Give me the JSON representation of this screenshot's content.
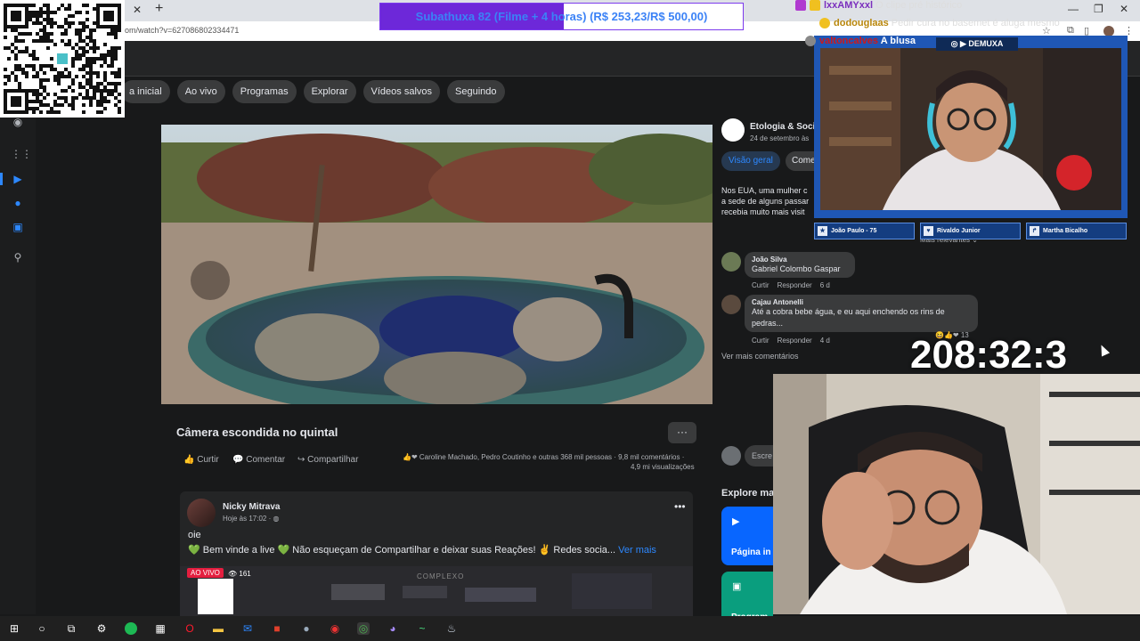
{
  "browser": {
    "url": "om/watch?v=627086802334471",
    "tab_close": "✕",
    "new_tab": "+",
    "window_controls": [
      "—",
      "❐",
      "✕"
    ]
  },
  "facebook": {
    "nav_pills": [
      "a inicial",
      "Ao vivo",
      "Programas",
      "Explorar",
      "Vídeos salvos",
      "Seguindo"
    ],
    "video": {
      "title": "Câmera escondida no quintal",
      "more": "···",
      "actions": {
        "like": "Curtir",
        "comment": "Comentar",
        "share": "Compartilhar"
      },
      "reactions": "Caroline Machado, Pedro Coutinho e outras 368 mil pessoas",
      "comments_count": "9,8 mil comentários ·",
      "views": "4,9 mi visualizações"
    },
    "side": {
      "page_name": "Etologia & Socio",
      "page_date": "24 de setembro às",
      "tab_overview": "Visão geral",
      "tab_comments": "Come",
      "description": [
        "Nos EUA, uma mulher c",
        "a sede de alguns passar",
        "recebia muito mais visit"
      ],
      "relevant": "Mais relevantes ⌄",
      "comments": [
        {
          "author": "João Silva",
          "text": "Gabriel Colombo Gaspar",
          "like": "Curtir",
          "reply": "Responder",
          "age": "6 d"
        },
        {
          "author": "Cajau Antonelli",
          "text1": "Até a cobra bebe água, e eu aqui enchendo os rins de",
          "text2": "pedras...",
          "like": "Curtir",
          "reply": "Responder",
          "age": "4 d",
          "reactions": "13"
        }
      ],
      "see_more_comments": "Ver mais comentários",
      "write_placeholder": "Escre",
      "explore_title": "Explore ma",
      "explore_cards": [
        {
          "label": "Página in",
          "icon": "▶"
        },
        {
          "label": "Program",
          "icon": "▣"
        }
      ]
    },
    "post": {
      "author": "Nicky Mitrava",
      "time": "Hoje às 17:02 · ",
      "line1": "oie",
      "line2": "💚 Bem vinde a live 💚 Não esqueçam de Compartilhar e deixar suas Reações! ✌ Redes socia... ",
      "see_more": "Ver mais",
      "live_badge": "AO VIVO",
      "viewers": "👁 161",
      "media_logo": "COMPLEXO"
    }
  },
  "overlay": {
    "subathon": "Subathuxa 82 (Filme + 4 horas) (R$ 253,23/R$ 500,00)",
    "subathon_progress": 0.5065,
    "chat": [
      {
        "user": "lxxAMYxxl",
        "message": "O clipe pré histórico",
        "color": "#7b2fbe"
      },
      {
        "user": "dodouglaas",
        "message": "Pedir cura no basemet é aluga mesmo",
        "color": "#b8860b"
      },
      {
        "user": "valtoncalves",
        "message": "A blusa",
        "color": "#d01818"
      }
    ],
    "cam_tag": "◎ ▶ DEMUXA",
    "guests": [
      {
        "icon": "★",
        "name": "João Paulo - 75"
      },
      {
        "icon": "♥",
        "name": "Rivaldo Junior"
      },
      {
        "icon": "↱",
        "name": "Martha Bicalho"
      }
    ],
    "timer": "208:32:3"
  },
  "colors": {
    "fb_bg": "#18191a",
    "fb_card": "#242526",
    "fb_blue": "#2d88ff",
    "banner_fill": "#6d28d9",
    "cam_frame": "#1f57b5"
  },
  "icons": [
    "qr-code",
    "windows-icon",
    "search-icon",
    "task-view-icon",
    "gear-icon",
    "spotify-icon",
    "calculator-icon",
    "opera-icon",
    "folder-icon",
    "mail-icon",
    "chrome-icon",
    "steam-icon"
  ]
}
